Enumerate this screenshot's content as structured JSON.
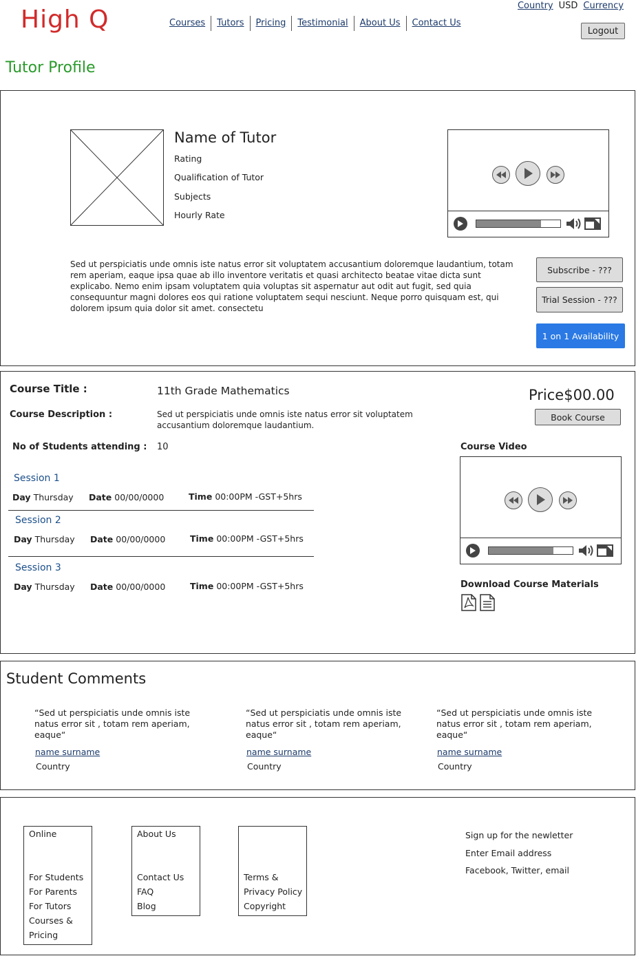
{
  "header": {
    "logo": "High Q",
    "nav": [
      "Courses",
      "Tutors",
      "Pricing",
      "Testimonial",
      "About Us",
      "Contact Us"
    ],
    "country_link": "Country",
    "currency_value": "USD",
    "currency_link": "Currency",
    "logout": "Logout"
  },
  "page_title": "Tutor Profile",
  "tutor": {
    "name": "Name of Tutor",
    "rating": "Rating",
    "qualification": "Qualification of Tutor",
    "subjects": "Subjects",
    "hourly_rate": "Hourly Rate",
    "bio": "Sed ut perspiciatis unde omnis iste natus error sit voluptatem accusantium doloremque laudantium, totam rem aperiam, eaque ipsa quae ab illo inventore veritatis et quasi architecto beatae vitae dicta sunt explicabo. Nemo enim ipsam voluptatem quia voluptas sit aspernatur aut odit aut fugit, sed quia consequuntur magni dolores eos qui ratione voluptatem sequi nesciunt. Neque porro quisquam est, qui dolorem ipsum quia dolor sit amet. consectetu",
    "subscribe": "Subscribe - ???",
    "trial": "Trial Session - ???",
    "availability": "1 on 1 Availability",
    "video_progress": 0.77
  },
  "course": {
    "title_label": "Course Title :",
    "title_value": "11th Grade Mathematics",
    "desc_label": "Course Description :",
    "desc_value": "Sed ut perspiciatis unde omnis iste natus error sit voluptatem accusantium doloremque laudantium.",
    "price_label": "Price",
    "price_value": "$00.00",
    "book": "Book Course",
    "students_label": "No of Students attending :",
    "students_value": "10",
    "video_label": "Course Video",
    "video_progress": 0.77,
    "download_label": "Download Course Materials",
    "sessions": [
      {
        "title": "Session  1",
        "day_label": "Day",
        "day": "Thursday",
        "date_label": "Date",
        "date": "00/00/0000",
        "time_label": "Time",
        "time": "00:00PM -GST+5hrs"
      },
      {
        "title": "Session 2",
        "day_label": "Day",
        "day": "Thursday",
        "date_label": "Date",
        "date": "00/00/0000",
        "time_label": "Time",
        "time": "00:00PM -GST+5hrs"
      },
      {
        "title": "Session 3",
        "day_label": "Day",
        "day": "Thursday",
        "date_label": "Date",
        "date": "00/00/0000",
        "time_label": "Time",
        "time": "00:00PM -GST+5hrs"
      }
    ]
  },
  "comments": {
    "heading": "Student Comments",
    "items": [
      {
        "text": "“Sed ut perspiciatis unde omnis iste natus error sit , totam rem aperiam, eaque“",
        "name": "name surname",
        "country": "Country"
      },
      {
        "text": "“Sed ut perspiciatis unde omnis iste natus error sit , totam rem aperiam, eaque“",
        "name": "name surname",
        "country": "Country"
      },
      {
        "text": "“Sed ut perspiciatis unde omnis iste natus error sit , totam rem aperiam, eaque“",
        "name": "name surname",
        "country": "Country"
      }
    ]
  },
  "footer": {
    "col1": [
      "Online",
      "For Students",
      "For Parents",
      "For Tutors",
      "Courses &",
      "Pricing"
    ],
    "col2": [
      "About Us",
      "Contact Us",
      "FAQ",
      "Blog"
    ],
    "col3": [
      "Terms &",
      "Privacy Policy",
      "Copyright"
    ],
    "newsletter": "Sign up for the newletter",
    "email": "Enter Email address",
    "social": "Facebook, Twitter, email"
  }
}
